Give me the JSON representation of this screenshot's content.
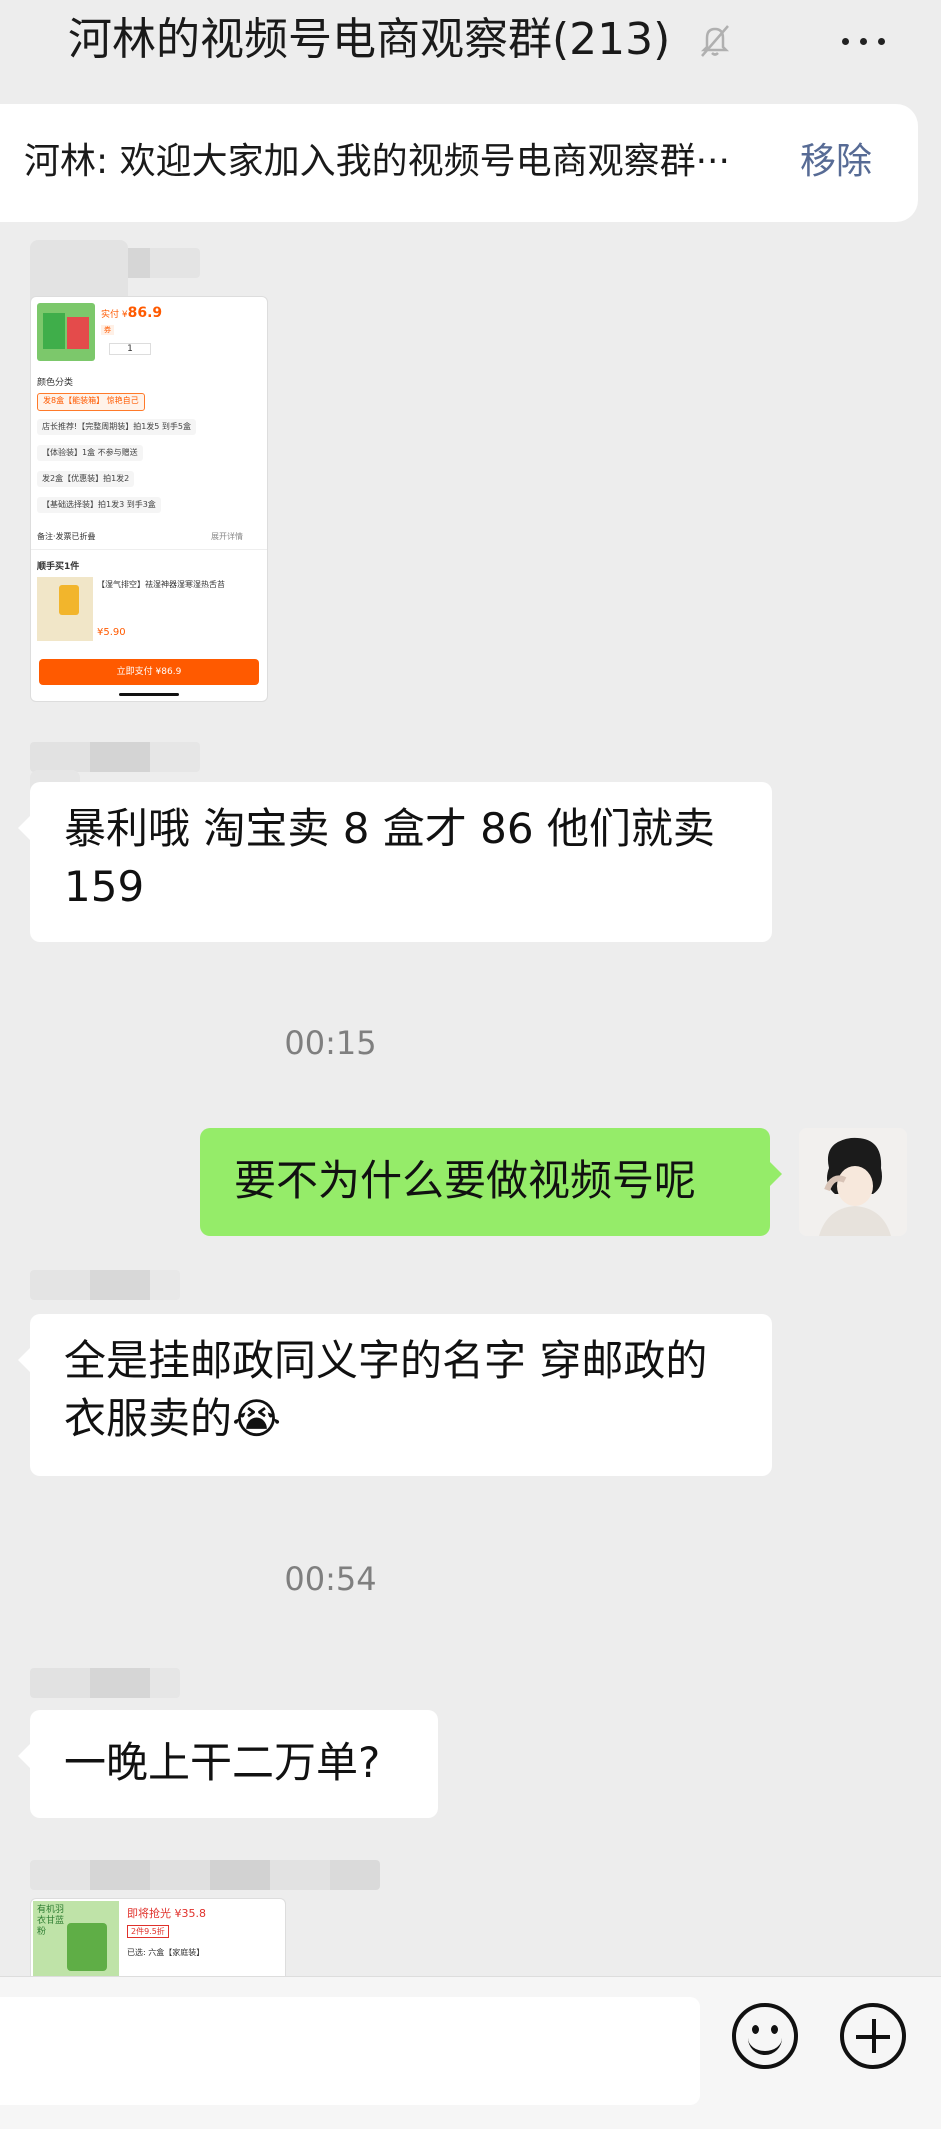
{
  "chat": {
    "title": "河林的视频号电商观察群(213)",
    "muted_icon": "bell-off-icon",
    "more_icon": "more-dots-icon"
  },
  "pinned": {
    "text": "河林: 欢迎大家加入我的视频号电商观察群···",
    "remove_label": "移除"
  },
  "screenshot1": {
    "price_label": "实付 ¥",
    "price": "86.9",
    "qty": "1",
    "section": "颜色分类",
    "chips": [
      "发8盒【能装箱】 惊艳自己",
      "店长推荐!【完整周期装】拍1发5 到手5盒",
      "【体验装】1盒 不参与赠送",
      "发2盒【优惠装】拍1发2",
      "【基础选择装】拍1发3 到手3盒"
    ],
    "remark": "备注·发票已折叠",
    "expand": "展开详情",
    "addon_title": "顺手买1件",
    "addon_desc": "【湿气排空】祛湿神器湿寒湿热舌苔",
    "addon_price": "¥5.90",
    "pay_button": "立即支付 ¥86.9"
  },
  "messages": {
    "m1": "暴利哦 淘宝卖 8 盒才 86 他们就卖 159",
    "t1": "00:15",
    "m2": "要不为什么要做视频号呢",
    "m3": "全是挂邮政同义字的名字 穿邮政的衣服卖的😭",
    "t2": "00:54",
    "m4": "一晚上干二万单?"
  },
  "screenshot2": {
    "flash": "即将抢光",
    "price": "¥35.8",
    "discount": "2件9.5折",
    "selected": "已选: 六盒【家庭装】",
    "badge": "有机羽衣甘蓝粉"
  },
  "input": {
    "emoji_icon": "emoji-icon",
    "plus_icon": "plus-icon"
  }
}
